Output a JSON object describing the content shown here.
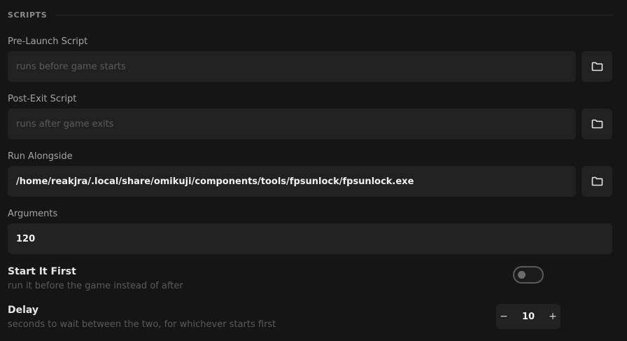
{
  "section": {
    "title": "SCRIPTS"
  },
  "pre_launch": {
    "label": "Pre-Launch Script",
    "placeholder": "runs before game starts",
    "value": "",
    "browse_icon": "folder-icon"
  },
  "post_exit": {
    "label": "Post-Exit Script",
    "placeholder": "runs after game exits",
    "value": "",
    "browse_icon": "folder-icon"
  },
  "run_alongside": {
    "label": "Run Alongside",
    "value": "/home/reakjra/.local/share/omikuji/components/tools/fpsunlock/fpsunlock.exe",
    "browse_icon": "folder-icon"
  },
  "arguments": {
    "label": "Arguments",
    "value": "120"
  },
  "start_it_first": {
    "title": "Start It First",
    "description": "run it before the game instead of after",
    "enabled": false
  },
  "delay": {
    "title": "Delay",
    "description": "seconds to wait between the two, for whichever starts first",
    "value": "10",
    "decrement_label": "−",
    "increment_label": "+"
  },
  "colors": {
    "background": "#151515",
    "field_background": "#212121",
    "label_text": "#a4a4a4",
    "muted_text": "#5a5a5a"
  }
}
